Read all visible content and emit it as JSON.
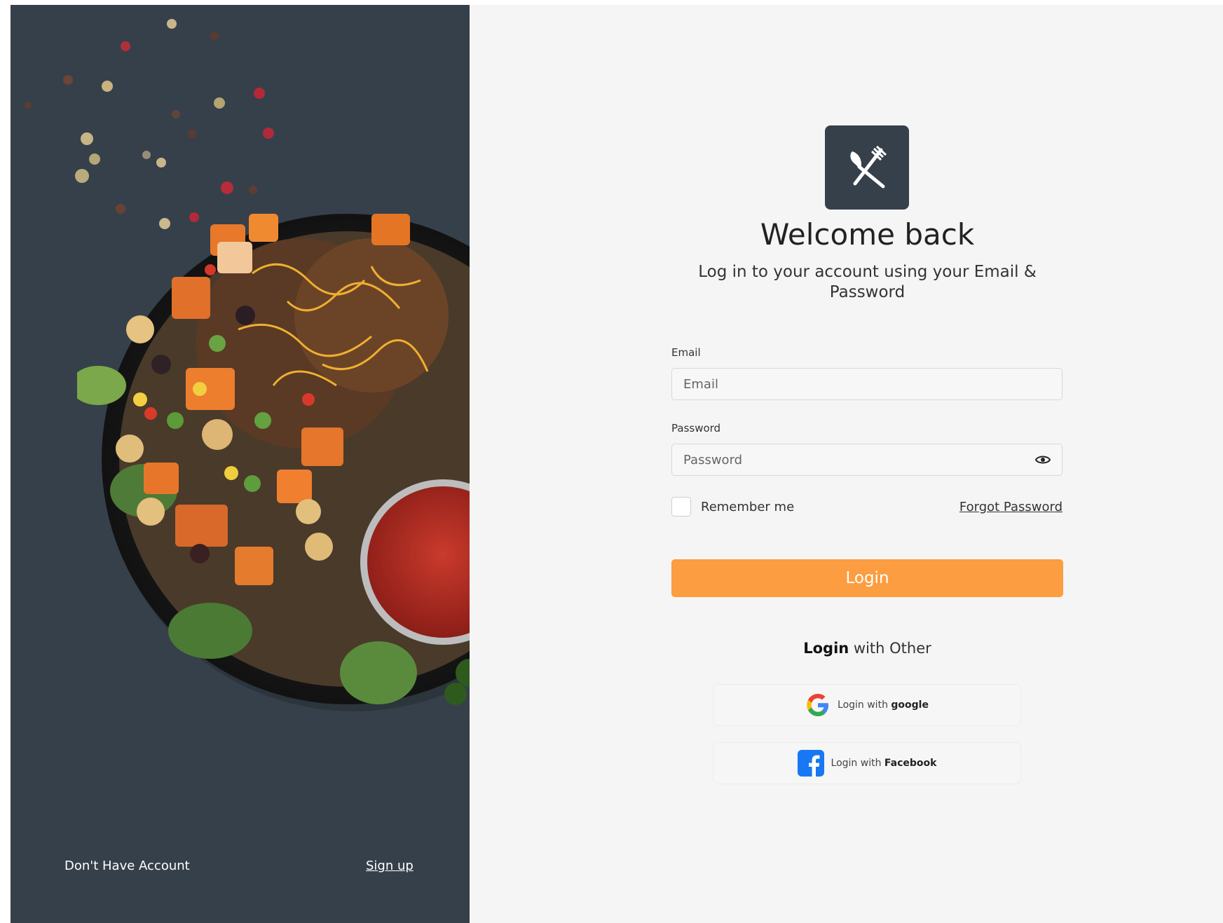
{
  "left": {
    "no_account_text": "Don't Have Account",
    "signup_link": "Sign up"
  },
  "colors": {
    "panel_dark": "#36404a",
    "accent_orange": "#fb9d40",
    "background_light": "#f5f5f5"
  },
  "header": {
    "logo_icon": "utensils-icon",
    "title": "Welcome back",
    "subtitle": "Log in to your account using your Email & Password"
  },
  "form": {
    "email_label": "Email",
    "email_placeholder": "Email",
    "password_label": "Password",
    "password_placeholder": "Password",
    "remember_label": "Remember me",
    "forgot_link": "Forgot Password",
    "login_button": "Login"
  },
  "social": {
    "title_bold": "Login",
    "title_rest": " with Other",
    "google_prefix": "Login with ",
    "google_brand": "google",
    "facebook_prefix": "Login with ",
    "facebook_brand": "Facebook"
  }
}
